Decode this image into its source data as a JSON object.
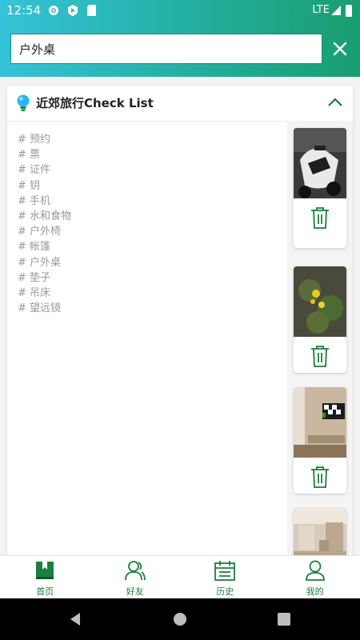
{
  "status": {
    "time": "12:54",
    "network": "LTE"
  },
  "search": {
    "value": "户外桌"
  },
  "card": {
    "title": "近郊旅行Check List",
    "tags": [
      "# 预约",
      "# 票",
      "# 证件",
      "# 钥",
      "# 手机",
      "# 水和食物",
      "# 户外椅",
      "# 帐篷",
      "# 户外桌",
      "# 垫子",
      "# 吊床",
      "# 望远镜"
    ],
    "photos": [
      "scooter-photo",
      "yellow-flowers-photo",
      "room-interior-photo",
      "living-room-photo"
    ]
  },
  "tabs": [
    {
      "label": "首页",
      "icon": "home-book-icon"
    },
    {
      "label": "好友",
      "icon": "friends-icon"
    },
    {
      "label": "历史",
      "icon": "calendar-icon"
    },
    {
      "label": "我的",
      "icon": "profile-icon"
    }
  ],
  "colors": {
    "accent": "#1a7f3c",
    "header_start": "#35c3d9",
    "header_end": "#1a9d6f",
    "tag_text": "#9a9a9a"
  }
}
